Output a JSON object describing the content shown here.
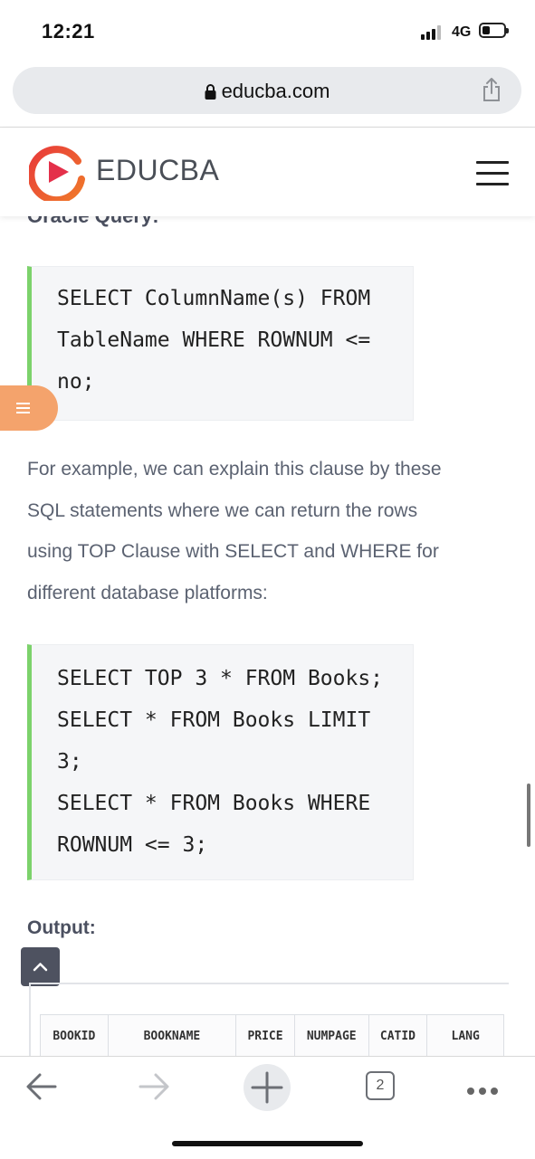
{
  "status": {
    "time": "12:21",
    "network": "4G"
  },
  "browser": {
    "url": "educba.com"
  },
  "site": {
    "brand": "EDUCBA"
  },
  "article": {
    "clipped_heading": "Oracle Query:",
    "code1": [
      "SELECT ColumnName(s) FROM",
      "TableName WHERE ROWNUM <=",
      "no;"
    ],
    "paragraph": [
      "For example, we can explain this clause by these",
      "SQL statements where we can return the rows",
      "using TOP Clause with SELECT and WHERE for",
      "different database platforms:"
    ],
    "code2": [
      "SELECT TOP 3 * FROM Books;",
      "SELECT * FROM Books LIMIT",
      "3;",
      "SELECT * FROM Books WHERE",
      "ROWNUM <= 3;"
    ],
    "output_label": "Output:",
    "table_headers": [
      "BOOKID",
      "BOOKNAME",
      "PRICE",
      "NUMPAGE",
      "CATID",
      "LANG"
    ]
  },
  "toolbar": {
    "tab_count": "2"
  },
  "colors": {
    "accent_green": "#7cd26b",
    "fab_orange": "#f4a36c",
    "brand_red": "#e8363f"
  }
}
